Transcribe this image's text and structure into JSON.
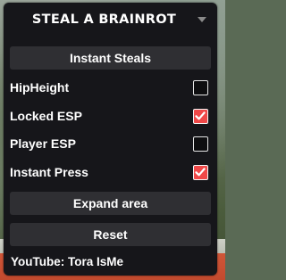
{
  "window": {
    "title": "STEAL A BRAINROT"
  },
  "buttons": {
    "instant_steals": "Instant Steals",
    "expand_area": "Expand area",
    "reset": "Reset"
  },
  "toggles": [
    {
      "label": "HipHeight",
      "checked": false
    },
    {
      "label": "Locked ESP",
      "checked": true
    },
    {
      "label": "Player ESP",
      "checked": false
    },
    {
      "label": "Instant Press",
      "checked": true
    }
  ],
  "footer": {
    "credit": "YouTube: Tora IsMe"
  },
  "colors": {
    "panel": "#16161a",
    "button": "#2f2f33",
    "checked": "#f04848",
    "text": "#ffffff"
  },
  "icons": {
    "collapse": "chevron-down-icon",
    "checked": "checkmark-icon"
  }
}
